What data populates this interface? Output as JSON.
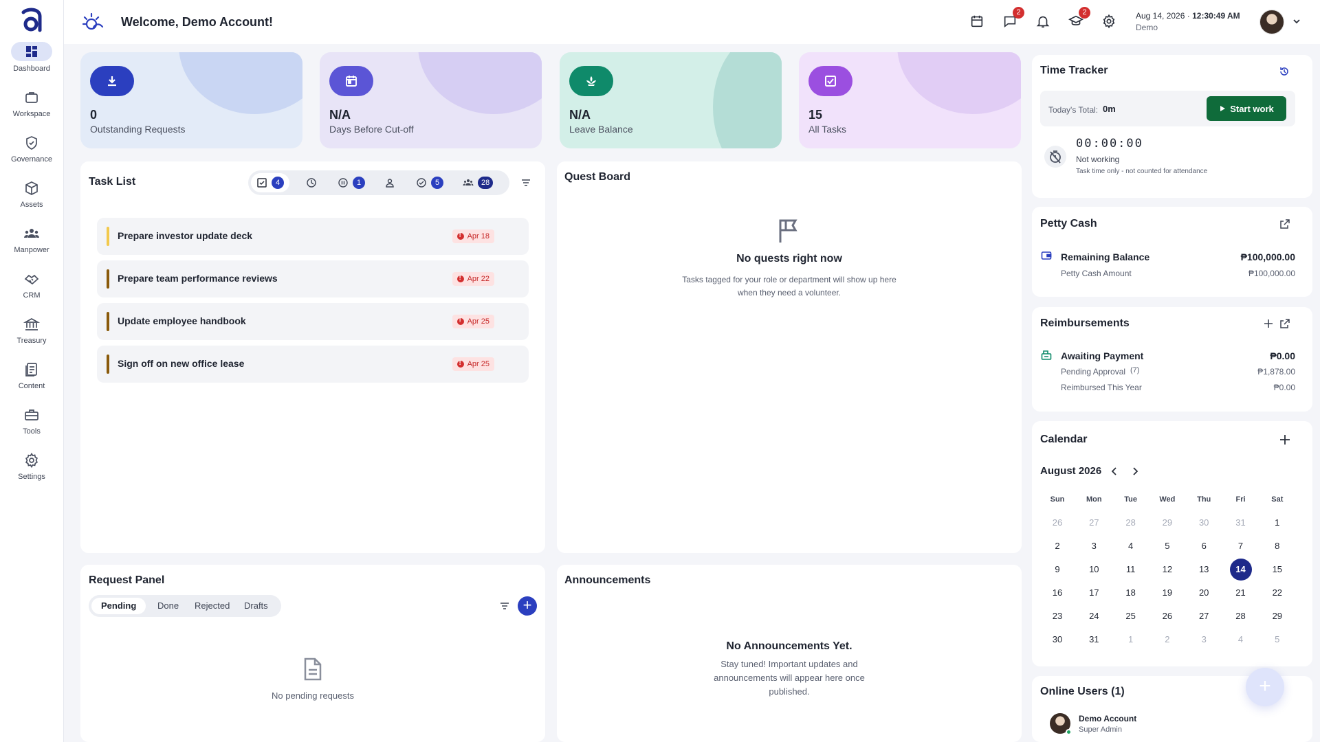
{
  "sidebar": {
    "items": [
      {
        "label": "Dashboard",
        "icon": "dashboard-icon",
        "active": true
      },
      {
        "label": "Workspace",
        "icon": "briefcase-icon"
      },
      {
        "label": "Governance",
        "icon": "shield-icon"
      },
      {
        "label": "Assets",
        "icon": "cube-icon"
      },
      {
        "label": "Manpower",
        "icon": "people-icon"
      },
      {
        "label": "CRM",
        "icon": "handshake-icon"
      },
      {
        "label": "Treasury",
        "icon": "bank-icon"
      },
      {
        "label": "Content",
        "icon": "document-icon"
      },
      {
        "label": "Tools",
        "icon": "toolbox-icon"
      },
      {
        "label": "Settings",
        "icon": "gear-icon"
      }
    ]
  },
  "header": {
    "welcome": "Welcome, Demo Account!",
    "messages_badge": "2",
    "learning_badge": "2",
    "date": "Aug 14, 2026",
    "separator": "·",
    "time": "12:30:49 AM",
    "user": "Demo"
  },
  "stats": [
    {
      "value": "0",
      "label": "Outstanding Requests",
      "icon": "download-icon",
      "bg": "#e3ebf8",
      "blob": "#c9d6f3",
      "iconbg": "#2b3fbf"
    },
    {
      "value": "N/A",
      "label": "Days Before Cut-off",
      "icon": "calendar-icon",
      "bg": "#e8e4f7",
      "blob": "#d6cef3",
      "iconbg": "#5b55d6"
    },
    {
      "value": "N/A",
      "label": "Leave Balance",
      "icon": "lotus-icon",
      "bg": "#d3efe8",
      "blob": "#b4ddd6",
      "iconbg": "#0f8a6a"
    },
    {
      "value": "15",
      "label": "All Tasks",
      "icon": "checkbox-icon",
      "bg": "#f1e2fb",
      "blob": "#e1cdf5",
      "iconbg": "#9b4fe0"
    }
  ],
  "task_list": {
    "title": "Task List",
    "counts": {
      "all": "4",
      "paused": "1",
      "done": "5",
      "team": "28"
    },
    "tasks": [
      {
        "name": "Prepare investor update deck",
        "due": "Apr 18",
        "color": "#f2c94c"
      },
      {
        "name": "Prepare team performance reviews",
        "due": "Apr 22",
        "color": "#8a5a0b"
      },
      {
        "name": "Update employee handbook",
        "due": "Apr 25",
        "color": "#8a5a0b"
      },
      {
        "name": "Sign off on new office lease",
        "due": "Apr 25",
        "color": "#8a5a0b"
      }
    ]
  },
  "quest_board": {
    "title": "Quest Board",
    "empty_title": "No quests right now",
    "empty_line1": "Tasks tagged for your role or department will show up here",
    "empty_line2": "when they need a volunteer."
  },
  "request_panel": {
    "title": "Request Panel",
    "tabs": [
      "Pending",
      "Done",
      "Rejected",
      "Drafts"
    ],
    "empty": "No pending requests"
  },
  "announcements": {
    "title": "Announcements",
    "empty_title": "No Announcements Yet.",
    "line1": "Stay tuned! Important updates and",
    "line2": "announcements will appear here once",
    "line3": "published."
  },
  "time_tracker": {
    "title": "Time Tracker",
    "total_label": "Today's Total:",
    "total_value": "0m",
    "start_label": "Start work",
    "clock": "00:00:00",
    "status": "Not working",
    "note": "Task time only - not counted for attendance"
  },
  "petty_cash": {
    "title": "Petty Cash",
    "remaining_label": "Remaining Balance",
    "remaining_value": "₱100,000.00",
    "amount_label": "Petty Cash Amount",
    "amount_value": "₱100,000.00"
  },
  "reimbursements": {
    "title": "Reimbursements",
    "awaiting_label": "Awaiting Payment",
    "awaiting_value": "₱0.00",
    "pending_label": "Pending Approval",
    "pending_count": "(7)",
    "pending_value": "₱1,878.00",
    "reimbursed_label": "Reimbursed This Year",
    "reimbursed_value": "₱0.00"
  },
  "calendar": {
    "title": "Calendar",
    "month": "August 2026",
    "weekdays": [
      "Sun",
      "Mon",
      "Tue",
      "Wed",
      "Thu",
      "Fri",
      "Sat"
    ],
    "days": [
      [
        "26",
        "27",
        "28",
        "29",
        "30",
        "31",
        "1"
      ],
      [
        "2",
        "3",
        "4",
        "5",
        "6",
        "7",
        "8"
      ],
      [
        "9",
        "10",
        "11",
        "12",
        "13",
        "14",
        "15"
      ],
      [
        "16",
        "17",
        "18",
        "19",
        "20",
        "21",
        "22"
      ],
      [
        "23",
        "24",
        "25",
        "26",
        "27",
        "28",
        "29"
      ],
      [
        "30",
        "31",
        "1",
        "2",
        "3",
        "4",
        "5"
      ]
    ],
    "today": "14"
  },
  "online_users": {
    "title": "Online Users (1)",
    "name": "Demo Account",
    "role": "Super Admin"
  }
}
